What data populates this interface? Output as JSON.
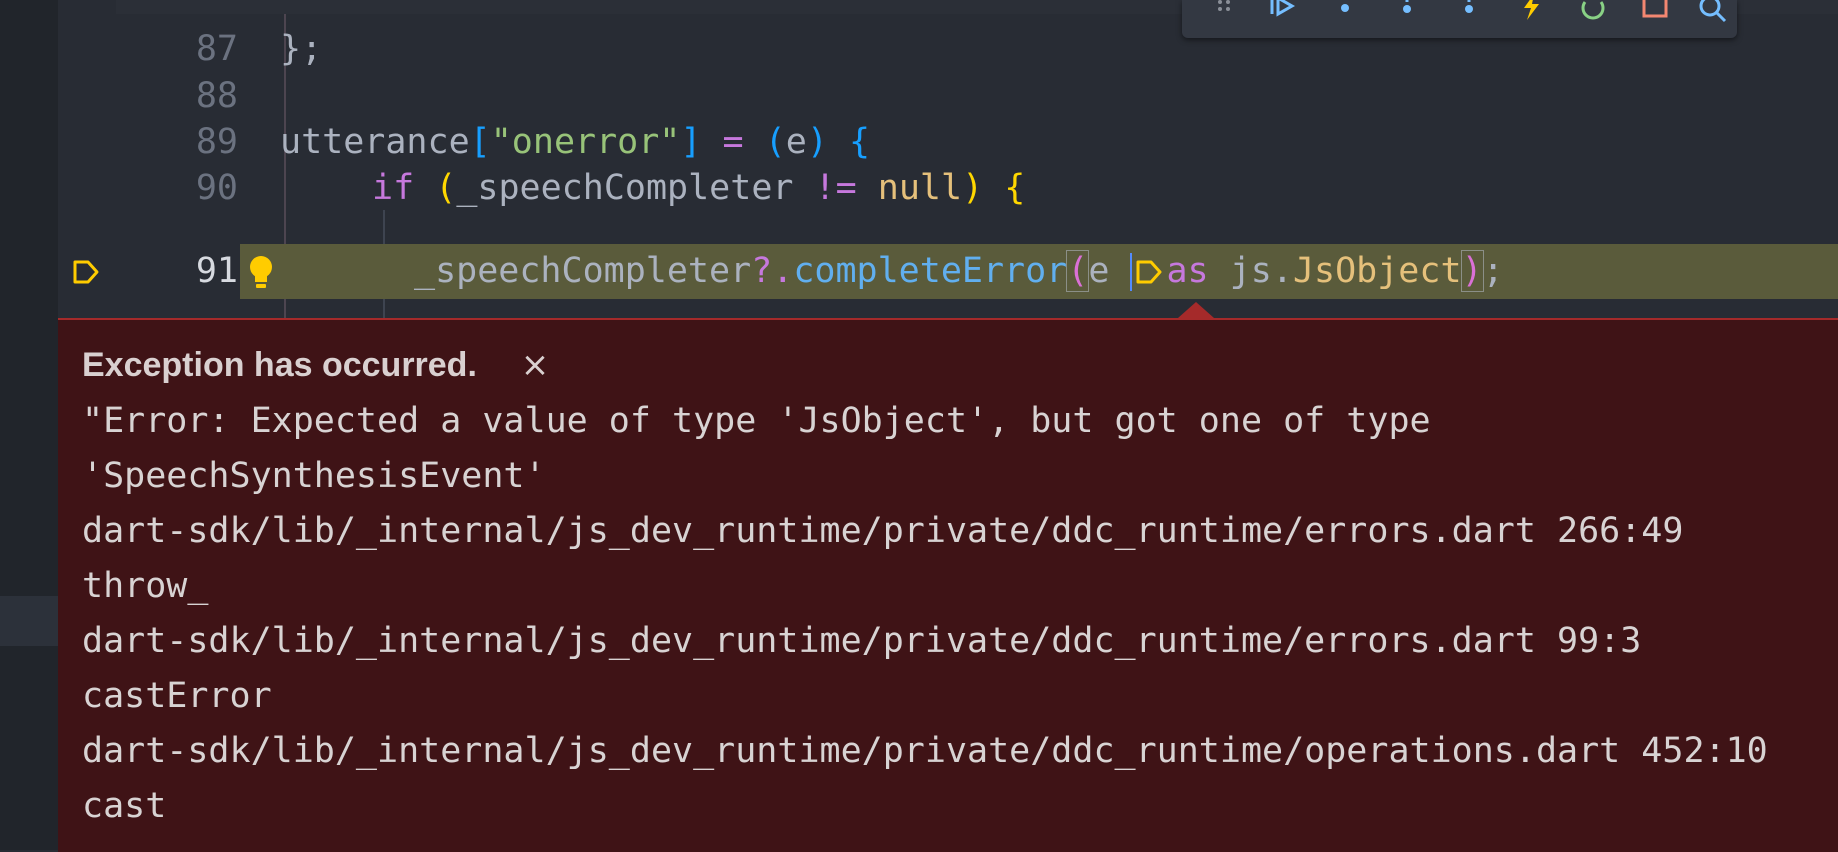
{
  "editor": {
    "lines": [
      {
        "num": "87",
        "code": "};"
      },
      {
        "num": "88",
        "code": ""
      },
      {
        "num": "89",
        "code_parts": [
          "utterance",
          "[",
          "\"onerror\"",
          "]",
          " = ",
          "(",
          "e",
          ")",
          " ",
          "{"
        ]
      },
      {
        "num": "90",
        "code_parts": [
          "if",
          " ",
          "(",
          "_speechCompleter",
          " != ",
          "null",
          ")",
          " ",
          "{"
        ]
      },
      {
        "num": "91",
        "code_parts": [
          "_speechCompleter",
          "?.",
          "completeError",
          "(",
          "e ",
          "as",
          " js.",
          "JsObject",
          ")",
          ";"
        ]
      }
    ]
  },
  "debug_toolbar": {
    "buttons": [
      "drag-handle-icon",
      "continue-icon",
      "step-over-icon",
      "step-into-icon",
      "step-out-icon",
      "hot-reload-icon",
      "restart-icon",
      "stop-icon",
      "devtools-icon"
    ]
  },
  "exception": {
    "title": "Exception has occurred.",
    "close_symbol": "×",
    "lines": [
      "\"Error: Expected a value of type 'JsObject', but got one of type",
      "'SpeechSynthesisEvent'",
      "dart-sdk/lib/_internal/js_dev_runtime/private/ddc_runtime/errors.dart 266:49",
      "throw_",
      "dart-sdk/lib/_internal/js_dev_runtime/private/ddc_runtime/errors.dart 99:3",
      "castError",
      "dart-sdk/lib/_internal/js_dev_runtime/private/ddc_runtime/operations.dart 452:10",
      "cast"
    ]
  },
  "colors": {
    "accent_breakpoint": "#ffcc00",
    "exception_background": "#3f1316",
    "current_line_highlight": "#5a5b3b"
  }
}
